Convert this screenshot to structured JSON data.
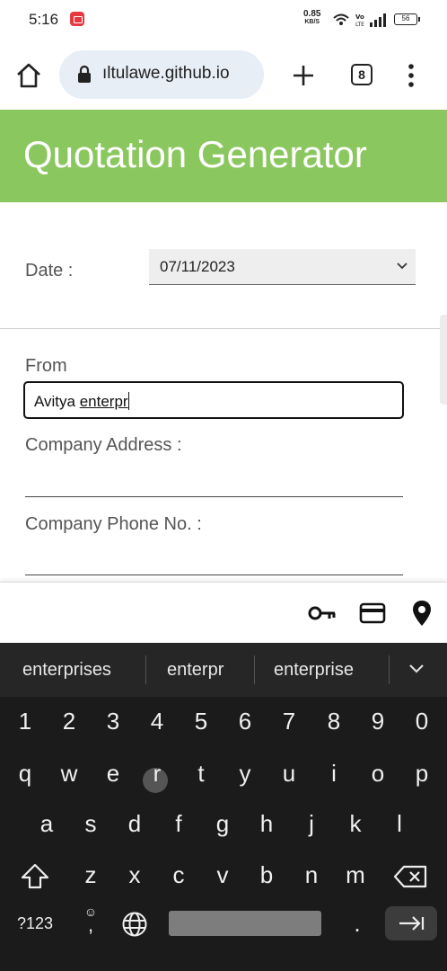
{
  "status": {
    "time": "5:16",
    "net_speed_value": "0.85",
    "net_speed_unit": "KB/S",
    "battery": "56"
  },
  "browser": {
    "url": "ıltulawe.github.io",
    "tab_count": "8"
  },
  "page": {
    "title": "Quotation Generator",
    "date_label": "Date :",
    "date_value": "07/11/2023",
    "from_label": "From",
    "from_value_prefix": "Avitya ",
    "from_value_composing": "enterpr",
    "address_label": "Company Address :",
    "phone_label": "Company Phone No. :"
  },
  "keyboard": {
    "suggestions": [
      "enterprises",
      "enterpr",
      "enterprise"
    ],
    "row_numbers": [
      "1",
      "2",
      "3",
      "4",
      "5",
      "6",
      "7",
      "8",
      "9",
      "0"
    ],
    "row1": [
      "q",
      "w",
      "e",
      "r",
      "t",
      "y",
      "u",
      "i",
      "o",
      "p"
    ],
    "row2": [
      "a",
      "s",
      "d",
      "f",
      "g",
      "h",
      "j",
      "k",
      "l"
    ],
    "row3": [
      "z",
      "x",
      "c",
      "v",
      "b",
      "n",
      "m"
    ],
    "symbols_label": "?123",
    "comma": ",",
    "period": "."
  },
  "colors": {
    "header": "#8bc75f",
    "keyboard_bg": "#1b1b1b"
  }
}
